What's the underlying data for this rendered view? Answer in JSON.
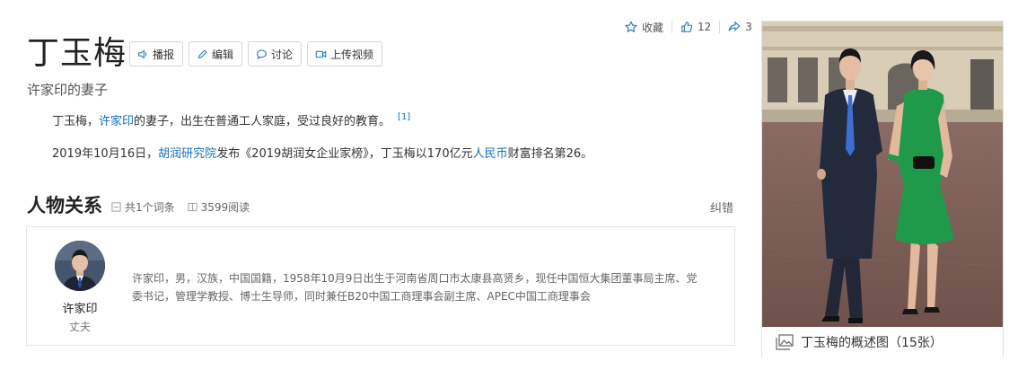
{
  "top_actions": {
    "favorite_label": "收藏",
    "like_count": "12",
    "share_count": "3"
  },
  "entry": {
    "title": "丁玉梅",
    "subtitle": "许家印的妻子",
    "buttons": {
      "broadcast": "播报",
      "edit": "编辑",
      "discuss": "讨论",
      "upload_video": "上传视频"
    }
  },
  "summary": {
    "p1_pre": "丁玉梅，",
    "p1_link": "许家印",
    "p1_post": "的妻子，出生在普通工人家庭，受过良好的教育。",
    "p1_ref": "[1]",
    "p2_pre": "2019年10月16日，",
    "p2_link1": "胡润研究院",
    "p2_mid": "发布《2019胡润女企业家榜》，丁玉梅以170亿元",
    "p2_link2": "人民币",
    "p2_post": "财富排名第26。"
  },
  "relations": {
    "section_title": "人物关系",
    "entry_count": "共1个词条",
    "read_count": "3599阅读",
    "correct_label": "纠错",
    "person": {
      "name": "许家印",
      "role": "丈夫",
      "description": "许家印，男，汉族，中国国籍，1958年10月9日出生于河南省周口市太康县高贤乡，现任中国恒大集团董事局主席、党委书记，管理学教授、博士生导师，同时兼任B20中国工商理事会副主席、APEC中国工商理事会"
    }
  },
  "album": {
    "caption": "丁玉梅的概述图（15张）"
  },
  "colors": {
    "link": "#136ec2",
    "dress": "#1f9a4a",
    "suit": "#232a3c"
  }
}
